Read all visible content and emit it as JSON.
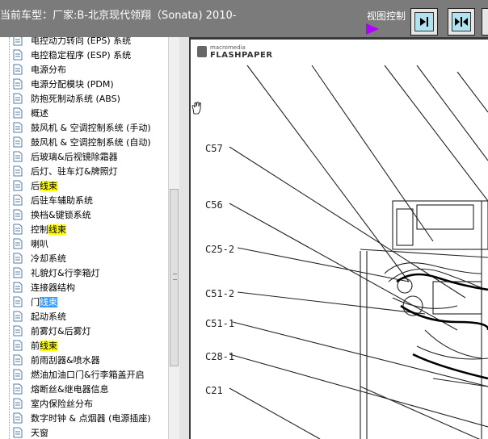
{
  "header": {
    "title": "当前车型：厂家:B-北京现代领翔（Sonata) 2010-",
    "view_control_label": "视图控制"
  },
  "sidebar": {
    "items": [
      {
        "pre": "电控动力转向 (EPS) 系统",
        "hl": "",
        "post": "",
        "hl_color": ""
      },
      {
        "pre": "电控稳定程序 (ESP) 系统",
        "hl": "",
        "post": "",
        "hl_color": ""
      },
      {
        "pre": "电源分布",
        "hl": "",
        "post": "",
        "hl_color": ""
      },
      {
        "pre": "电源分配模块 (PDM)",
        "hl": "",
        "post": "",
        "hl_color": ""
      },
      {
        "pre": "防抱死制动系统 (ABS)",
        "hl": "",
        "post": "",
        "hl_color": ""
      },
      {
        "pre": "概述",
        "hl": "",
        "post": "",
        "hl_color": ""
      },
      {
        "pre": "鼓风机 & 空调控制系统 (手动)",
        "hl": "",
        "post": "",
        "hl_color": ""
      },
      {
        "pre": "鼓风机 & 空调控制系统 (自动)",
        "hl": "",
        "post": "",
        "hl_color": ""
      },
      {
        "pre": "后玻璃&后视镜除霜器",
        "hl": "",
        "post": "",
        "hl_color": ""
      },
      {
        "pre": "后灯、驻车灯&牌照灯",
        "hl": "",
        "post": "",
        "hl_color": ""
      },
      {
        "pre": "后",
        "hl": "线束",
        "post": "",
        "hl_color": "yellow"
      },
      {
        "pre": "后驻车辅助系统",
        "hl": "",
        "post": "",
        "hl_color": ""
      },
      {
        "pre": "换档&键锁系统",
        "hl": "",
        "post": "",
        "hl_color": ""
      },
      {
        "pre": "控制",
        "hl": "线束",
        "post": "",
        "hl_color": "yellow"
      },
      {
        "pre": "喇叭",
        "hl": "",
        "post": "",
        "hl_color": ""
      },
      {
        "pre": "冷却系统",
        "hl": "",
        "post": "",
        "hl_color": ""
      },
      {
        "pre": "礼貌灯&行李箱灯",
        "hl": "",
        "post": "",
        "hl_color": ""
      },
      {
        "pre": "连接器结构",
        "hl": "",
        "post": "",
        "hl_color": ""
      },
      {
        "pre": "门",
        "hl": "线束",
        "post": "",
        "hl_color": "blue"
      },
      {
        "pre": "起动系统",
        "hl": "",
        "post": "",
        "hl_color": ""
      },
      {
        "pre": "前雾灯&后雾灯",
        "hl": "",
        "post": "",
        "hl_color": ""
      },
      {
        "pre": "前",
        "hl": "线束",
        "post": "",
        "hl_color": "yellow"
      },
      {
        "pre": "前雨刮器&喷水器",
        "hl": "",
        "post": "",
        "hl_color": ""
      },
      {
        "pre": "燃油加油口门&行李箱盖开启",
        "hl": "",
        "post": "",
        "hl_color": ""
      },
      {
        "pre": "熔断丝&继电器信息",
        "hl": "",
        "post": "",
        "hl_color": ""
      },
      {
        "pre": "室内保险丝分布",
        "hl": "",
        "post": "",
        "hl_color": ""
      },
      {
        "pre": "数字时钟 & 点烟器 (电源插座)",
        "hl": "",
        "post": "",
        "hl_color": ""
      },
      {
        "pre": "天窗",
        "hl": "",
        "post": "",
        "hl_color": ""
      }
    ]
  },
  "viewer": {
    "logo_small": "macromedia",
    "logo_big": "FLASHPAPER",
    "connector_labels": [
      "C57",
      "C56",
      "C25-2",
      "C51-2",
      "C51-1",
      "C28-1",
      "C21"
    ]
  },
  "colors": {
    "topbar": "#7b7b7b",
    "highlight_yellow": "#ffff00",
    "highlight_blue": "#3399ff",
    "arrow": "#b000ff",
    "button_face": "#aee3ef"
  }
}
